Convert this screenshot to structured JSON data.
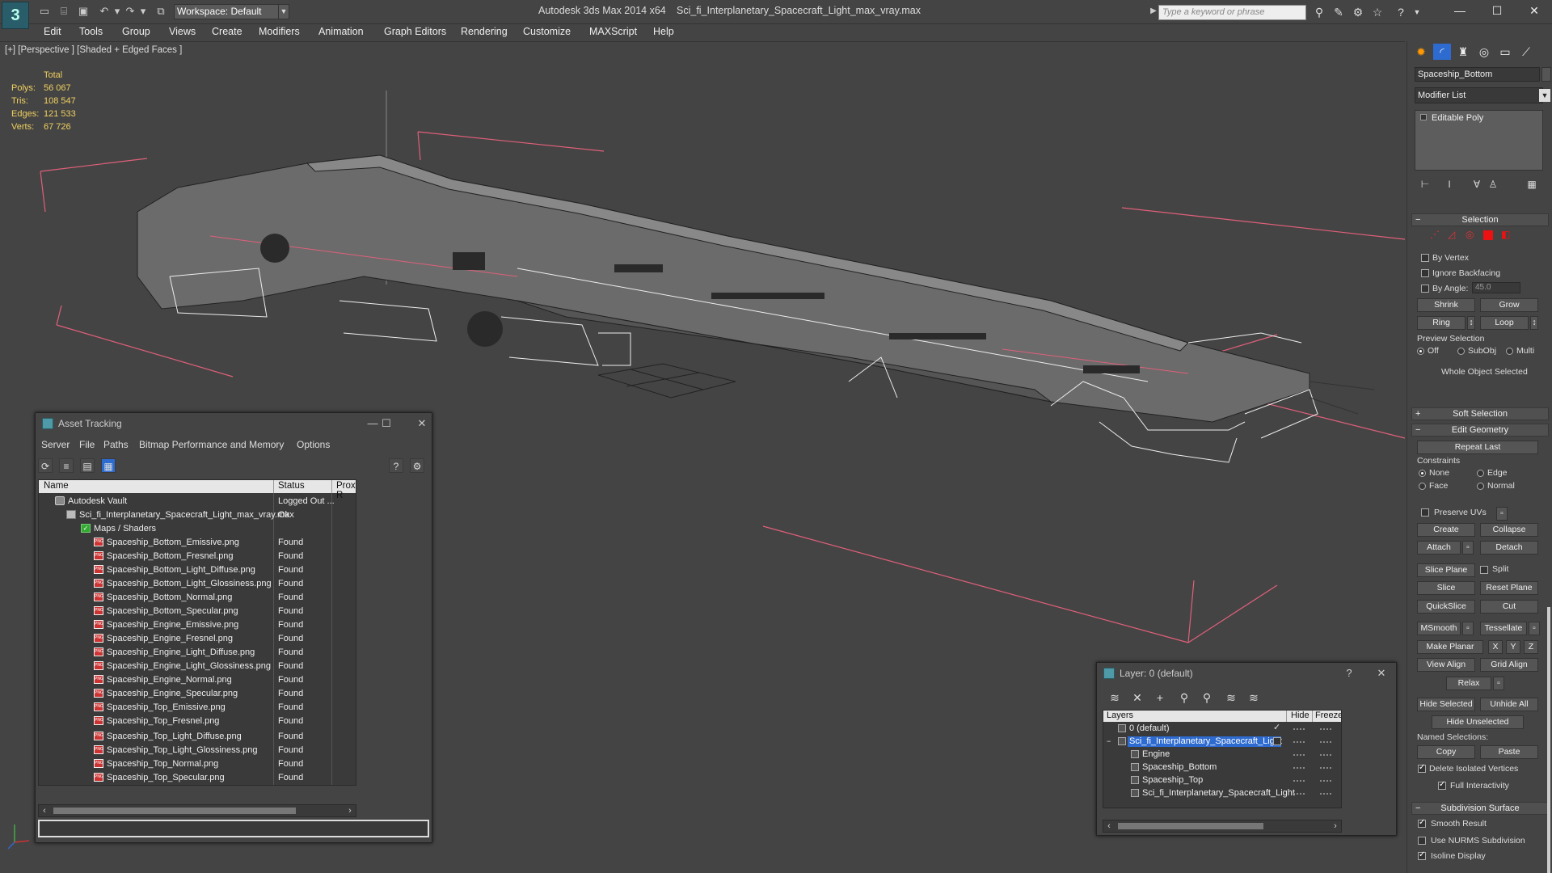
{
  "app": {
    "title": "Autodesk 3ds Max  2014 x64",
    "file": "Sci_fi_Interplanetary_Spacecraft_Light_max_vray.max",
    "logo": "3ds-max-logo",
    "workspace": "Workspace: Default",
    "search_placeholder": "Type a keyword or phrase"
  },
  "menu": [
    "Edit",
    "Tools",
    "Group",
    "Views",
    "Create",
    "Modifiers",
    "Animation",
    "Graph Editors",
    "Rendering",
    "Customize",
    "MAXScript",
    "Help"
  ],
  "viewport": {
    "label": "[+] [Perspective ] [Shaded + Edged Faces ]",
    "stats": {
      "header": "Total",
      "rows": [
        {
          "label": "Polys:",
          "value": "56 067"
        },
        {
          "label": "Tris:",
          "value": "108 547"
        },
        {
          "label": "Edges:",
          "value": "121 533"
        },
        {
          "label": "Verts:",
          "value": "67 726"
        }
      ]
    }
  },
  "command_panel": {
    "object_name": "Spaceship_Bottom",
    "modifier_list": "Modifier List",
    "stack_item": "Editable Poly",
    "selection": {
      "title": "Selection",
      "by_vertex": "By Vertex",
      "ignore_backfacing": "Ignore Backfacing",
      "by_angle": "By Angle:",
      "angle_value": "45.0",
      "shrink": "Shrink",
      "grow": "Grow",
      "ring": "Ring",
      "loop": "Loop",
      "preview_selection": "Preview Selection",
      "preview_off": "Off",
      "preview_subobj": "SubObj",
      "preview_multi": "Multi",
      "status": "Whole Object Selected"
    },
    "soft_selection": "Soft Selection",
    "edit_geometry": {
      "title": "Edit Geometry",
      "repeat_last": "Repeat Last",
      "constraints": "Constraints",
      "none": "None",
      "edge": "Edge",
      "face": "Face",
      "normal": "Normal",
      "preserve_uvs": "Preserve UVs",
      "create": "Create",
      "collapse": "Collapse",
      "attach": "Attach",
      "detach": "Detach",
      "slice_plane": "Slice Plane",
      "split": "Split",
      "slice": "Slice",
      "reset_plane": "Reset Plane",
      "quickslice": "QuickSlice",
      "cut": "Cut",
      "msmooth": "MSmooth",
      "tessellate": "Tessellate",
      "make_planar": "Make Planar",
      "x": "X",
      "y": "Y",
      "z": "Z",
      "view_align": "View Align",
      "grid_align": "Grid Align",
      "relax": "Relax",
      "hide_selected": "Hide Selected",
      "unhide_all": "Unhide All",
      "hide_unselected": "Hide Unselected",
      "named_selections": "Named Selections:",
      "copy": "Copy",
      "paste": "Paste",
      "delete_isolated": "Delete Isolated Vertices",
      "full_interactivity": "Full Interactivity"
    },
    "subdivision": {
      "title": "Subdivision Surface",
      "smooth_result": "Smooth Result",
      "use_nurms": "Use NURMS Subdivision",
      "isoline": "Isoline Display"
    }
  },
  "asset_tracking": {
    "title": "Asset Tracking",
    "menu": [
      "Server",
      "File",
      "Paths",
      "Bitmap Performance and Memory",
      "Options"
    ],
    "columns": [
      "Name",
      "Status",
      "Proxy R"
    ],
    "vault": {
      "name": "Autodesk Vault",
      "status": "Logged Out ..."
    },
    "file": {
      "name": "Sci_fi_Interplanetary_Spacecraft_Light_max_vray.max",
      "status": "Ok"
    },
    "maps_folder": "Maps / Shaders",
    "maps": [
      {
        "name": "Spaceship_Bottom_Emissive.png",
        "status": "Found"
      },
      {
        "name": "Spaceship_Bottom_Fresnel.png",
        "status": "Found"
      },
      {
        "name": "Spaceship_Bottom_Light_Diffuse.png",
        "status": "Found"
      },
      {
        "name": "Spaceship_Bottom_Light_Glossiness.png",
        "status": "Found"
      },
      {
        "name": "Spaceship_Bottom_Normal.png",
        "status": "Found"
      },
      {
        "name": "Spaceship_Bottom_Specular.png",
        "status": "Found"
      },
      {
        "name": "Spaceship_Engine_Emissive.png",
        "status": "Found"
      },
      {
        "name": "Spaceship_Engine_Fresnel.png",
        "status": "Found"
      },
      {
        "name": "Spaceship_Engine_Light_Diffuse.png",
        "status": "Found"
      },
      {
        "name": "Spaceship_Engine_Light_Glossiness.png",
        "status": "Found"
      },
      {
        "name": "Spaceship_Engine_Normal.png",
        "status": "Found"
      },
      {
        "name": "Spaceship_Engine_Specular.png",
        "status": "Found"
      },
      {
        "name": "Spaceship_Top_Emissive.png",
        "status": "Found"
      },
      {
        "name": "Spaceship_Top_Fresnel.png",
        "status": "Found"
      },
      {
        "name": "Spaceship_Top_Light_Diffuse.png",
        "status": "Found"
      },
      {
        "name": "Spaceship_Top_Light_Glossiness.png",
        "status": "Found"
      },
      {
        "name": "Spaceship_Top_Normal.png",
        "status": "Found"
      },
      {
        "name": "Spaceship_Top_Specular.png",
        "status": "Found"
      }
    ]
  },
  "layer": {
    "title": "Layer: 0 (default)",
    "columns": [
      "Layers",
      "Hide",
      "Freeze"
    ],
    "rows": [
      {
        "name": "0 (default)",
        "indent": 0,
        "selected": false
      },
      {
        "name": "Sci_fi_Interplanetary_Spacecraft_Light",
        "indent": 0,
        "selected": true
      },
      {
        "name": "Engine",
        "indent": 1,
        "selected": false
      },
      {
        "name": "Spaceship_Bottom",
        "indent": 1,
        "selected": false
      },
      {
        "name": "Spaceship_Top",
        "indent": 1,
        "selected": false
      },
      {
        "name": "Sci_fi_Interplanetary_Spacecraft_Light",
        "indent": 1,
        "selected": false
      }
    ]
  },
  "colors": {
    "background": "#444444",
    "selection": "#2e6bd0",
    "stats": "#f0d060",
    "bbox": "#e0607a"
  }
}
